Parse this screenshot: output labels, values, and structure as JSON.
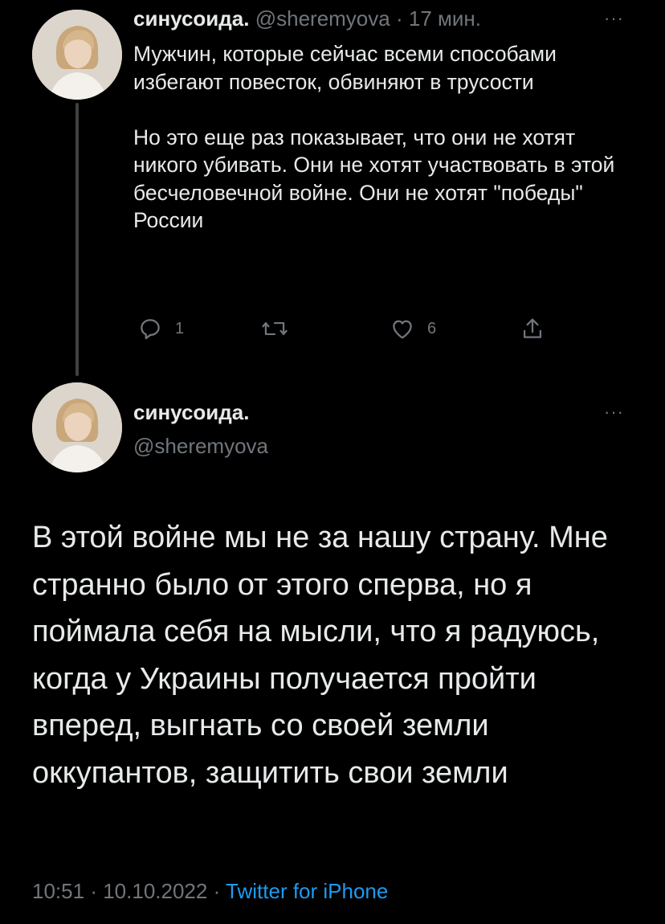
{
  "tweet1": {
    "display_name": "синусоида.",
    "handle": "@sheremyova",
    "separator": "·",
    "time_ago": "17 мин.",
    "paragraph1": "Мужчин, которые сейчас всеми способами избегают повесток, обвиняют в трусости",
    "paragraph2": "Но это еще раз показывает, что они не хотят никого убивать. Они не хотят участвовать в этой бесчеловечной войне. Они не хотят \"победы\" России",
    "reply_count": "1",
    "like_count": "6"
  },
  "tweet2": {
    "display_name": "синусоида.",
    "handle": "@sheremyova",
    "text": "В этой войне мы не за нашу страну. Мне странно было от этого сперва, но я поймала себя на мысли, что я радуюсь, когда у Украины получается пройти вперед, выгнать со своей земли оккупантов, защитить свои земли",
    "time": "10:51",
    "date": "10.10.2022",
    "separator": "·",
    "source": "Twitter for iPhone"
  },
  "more_label": "···",
  "colors": {
    "background": "#000000",
    "text": "#e7e9ea",
    "muted": "#71767b",
    "link": "#1d9bf0",
    "thread_line": "#3e4144"
  },
  "icons": [
    "avatar-photo",
    "reply-icon",
    "retweet-icon",
    "like-icon",
    "share-icon",
    "more-icon"
  ]
}
